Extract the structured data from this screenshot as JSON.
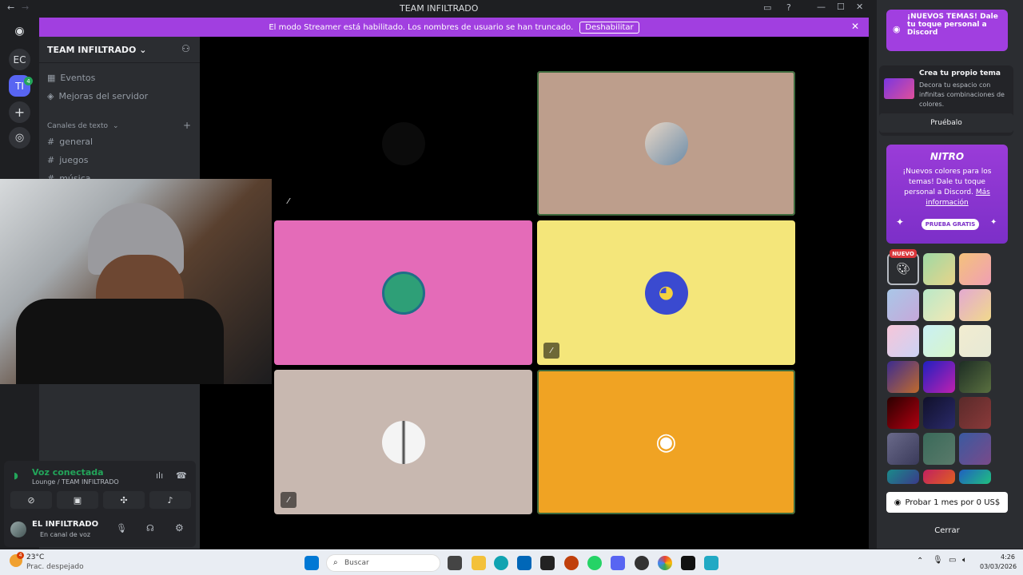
{
  "window": {
    "title": "TEAM INFILTRADO",
    "back": "←",
    "forward": "→"
  },
  "banner": {
    "text": "El modo Streamer está habilitado. Los nombres de usuario se han truncado.",
    "button": "Deshabilitar"
  },
  "servers": [
    {
      "label": "EC"
    },
    {
      "label": "TI",
      "badge": "4"
    }
  ],
  "server_header": {
    "name": "TEAM INFILTRADO"
  },
  "channels": {
    "top_items": [
      "Eventos",
      "Mejoras del servidor"
    ],
    "category": "Canales de texto",
    "text_channels": [
      "general",
      "juegos",
      "música"
    ]
  },
  "voice": {
    "status": "Voz conectada",
    "location": "Lounge / TEAM INFILTRADO"
  },
  "user": {
    "name": "EL INFILTRADO",
    "status": "En canal de voz"
  },
  "right_panel": {
    "promo_title": "¡NUEVOS TEMAS! Dale tu toque personal a Discord",
    "create_title": "Crea tu propio tema",
    "create_desc": "Decora tu espacio con infinitas combinaciones de colores.",
    "try_button": "Pruébalo",
    "nitro_logo": "NITRO",
    "nitro_text": "¡Nuevos colores para los temas! Dale tu toque personal a Discord.",
    "nitro_link": "Más información",
    "free_trial": "PRUEBA GRATIS",
    "new_badge": "NUEVO",
    "cta_button": "Probar 1 mes por 0 US$",
    "close_button": "Cerrar"
  },
  "taskbar": {
    "temp": "23°C",
    "weather": "Prac. despejado",
    "search_placeholder": "Buscar",
    "time": "4:26",
    "date": "03/03/2026",
    "weather_badge": "4"
  }
}
